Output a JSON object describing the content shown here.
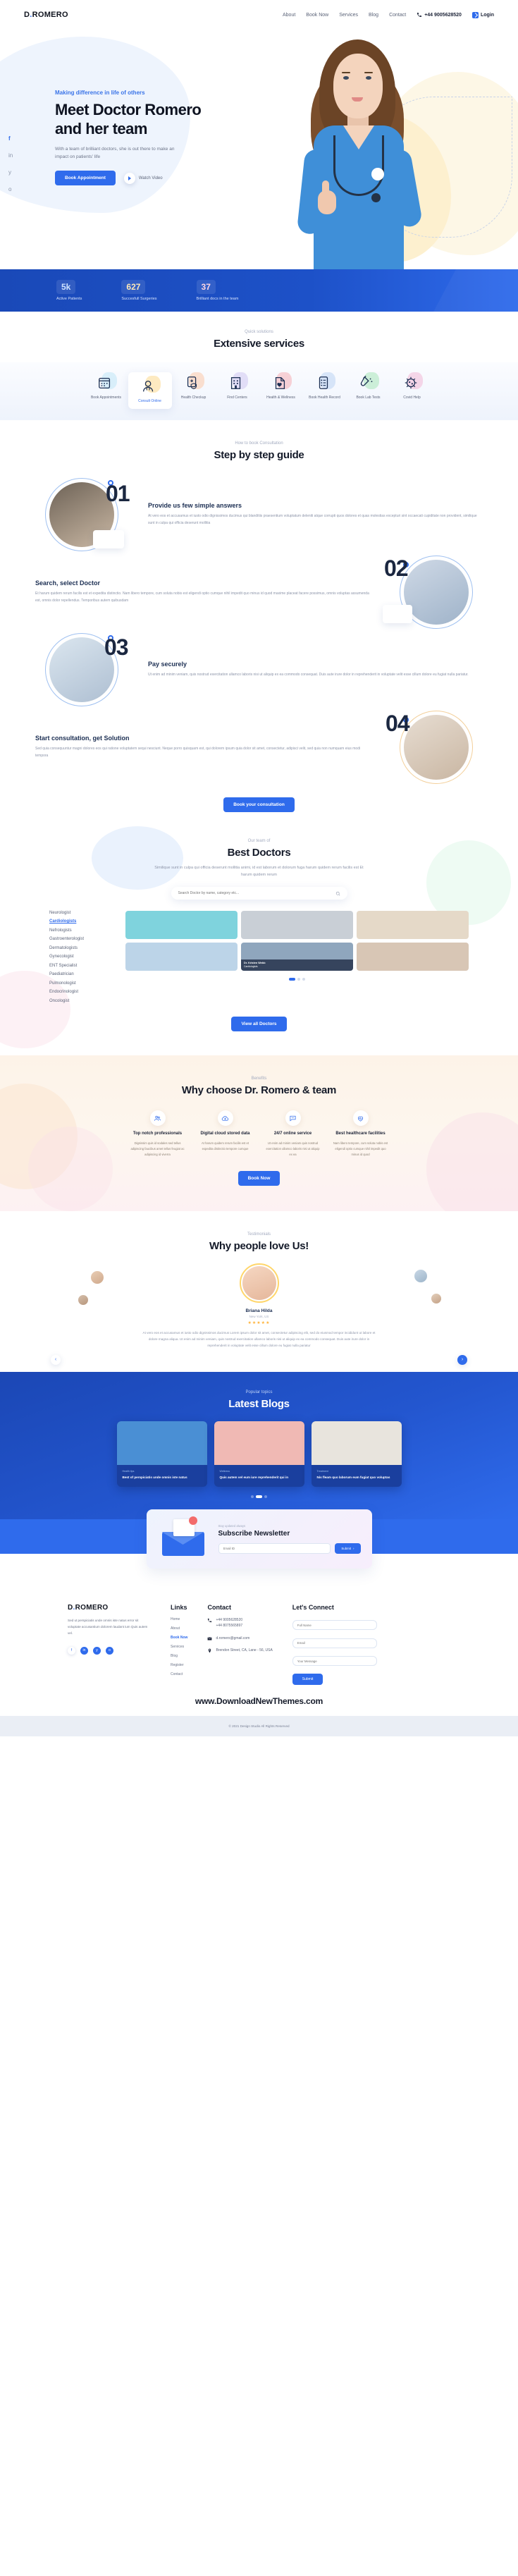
{
  "brand": {
    "name_prefix": "D",
    "name_dot": ".",
    "name_suffix": "ROMERO",
    "full": "D.ROMERO"
  },
  "nav": {
    "links": [
      {
        "label": "About"
      },
      {
        "label": "Book Now"
      },
      {
        "label": "Services"
      },
      {
        "label": "Blog"
      },
      {
        "label": "Contact"
      }
    ],
    "phone": "+44 9005628520",
    "login": "Login"
  },
  "hero": {
    "eyebrow": "Making difference in life of others",
    "title": "Meet Doctor Romero and her team",
    "description": "With a team of brilliant doctors, she is out there to make an impact on patients' life",
    "cta": "Book Appointment",
    "play_label": "Watch Video",
    "social": [
      "f",
      "in",
      "y",
      "o"
    ]
  },
  "stats": [
    {
      "value": "5k",
      "label": "Active Patients",
      "color": "#cfe4ff"
    },
    {
      "value": "627",
      "label": "Succesfull Surgeries",
      "color": "#fbe7b8"
    },
    {
      "value": "37",
      "label": "Brilliant docs in the team",
      "color": "#fbd6e3"
    }
  ],
  "services": {
    "eyebrow": "Quick solutions",
    "title": "Extensive services",
    "items": [
      {
        "label": "Book Appointments",
        "icon": "calendar-icon",
        "blob": "#bfe6f5",
        "active": false
      },
      {
        "label": "Consult Online",
        "icon": "doctor-avatar-icon",
        "blob": "#fbd98e",
        "active": true
      },
      {
        "label": "Health Checkup",
        "icon": "clipboard-shield-icon",
        "blob": "#fbc9a8",
        "active": false
      },
      {
        "label": "Find Centers",
        "icon": "hospital-icon",
        "blob": "#cfc6f0",
        "active": false
      },
      {
        "label": "Health & Wellness",
        "icon": "heart-pulse-doc-icon",
        "blob": "#f6aeb4",
        "active": false
      },
      {
        "label": "Book Health Record",
        "icon": "record-list-icon",
        "blob": "#bcd3f3",
        "active": false
      },
      {
        "label": "Book Lab Tests",
        "icon": "test-tube-icon",
        "blob": "#a8e6b8",
        "active": false
      },
      {
        "label": "Covid Help",
        "icon": "virus-icon",
        "blob": "#f3b8d6",
        "active": false
      }
    ]
  },
  "steps": {
    "eyebrow": "How to book Consultation",
    "title": "Step by step guide",
    "items": [
      {
        "number": "01",
        "heading": "Provide us few simple answers",
        "body": "At vero eos et accusamus et iusto odio dignissimos ducimus qui blanditiis praesentium voluptatum deleniti atque corrupti quos dolores et quas molestias excepturi sint occaecati cupiditate non provident, similique sunt in culpa qui officia deserunt mollitia"
      },
      {
        "number": "02",
        "heading": "Search, select Doctor",
        "body": "Et harum quidem rerum facilis est et expedita distinctio. Nam libero tempore, cum soluta nobis est eligendi optio cumque nihil impedit quo minus id quod maxime placeat facere possimus, omnis voluptas assumenda est, omnis dolor repellendus. Temporibus autem quibusdam"
      },
      {
        "number": "03",
        "heading": "Pay securely",
        "body": "Ut enim ad minim veniam, quis nostrud exercitation ullamco laboris nisi ut aliquip ex ea commodo consequat. Duis aute irure dolor in reprehenderit in voluptate velit esse cillum dolore eu fugiat nulla pariatur."
      },
      {
        "number": "04",
        "heading": "Start consultation, get Solution",
        "body": "Sed quia consequuntur magni dolores eos qui ratione voluptatem sequi nesciunt. Neque porro quisquam est, qui dolorem ipsum quia dolor sit amet, consectetur, adipisci velit, sed quia non numquam eius modi tempora"
      }
    ],
    "cta": "Book your consultation"
  },
  "doctors": {
    "eyebrow": "Our team of",
    "title": "Best Doctors",
    "subtitle": "Similique sunt in culpa qui officia deserunt mollitia animi, id est laborum et dolorum fuga harum quidem rerum facilis est Et harum quidem rerum",
    "search_placeholder": "Search Doctor by name, category etc...",
    "specialties": [
      {
        "label": "Neurologist",
        "active": false
      },
      {
        "label": "Cardiologists",
        "active": true
      },
      {
        "label": "Nefrologists",
        "active": false
      },
      {
        "label": "Gastroenterologist",
        "active": false
      },
      {
        "label": "Dermatologists",
        "active": false
      },
      {
        "label": "Gynecologist",
        "active": false
      },
      {
        "label": "ENT Specialist",
        "active": false
      },
      {
        "label": "Paediatrician",
        "active": false
      },
      {
        "label": "Pulmonologist",
        "active": false
      },
      {
        "label": "Endocrinologist",
        "active": false
      },
      {
        "label": "Oncologist",
        "active": false
      }
    ],
    "cards": [
      {
        "name": "",
        "role": "",
        "bg": "#7fd3dd",
        "featured": false
      },
      {
        "name": "",
        "role": "",
        "bg": "#c9cfd6",
        "featured": false
      },
      {
        "name": "",
        "role": "",
        "bg": "#e5d9c8",
        "featured": false
      },
      {
        "name": "",
        "role": "",
        "bg": "#bcd4e8",
        "featured": false
      },
      {
        "name": "Dr. Kristen Webb",
        "role": "Cardiologists",
        "bg": "#8fa6bd",
        "featured": true
      },
      {
        "name": "",
        "role": "",
        "bg": "#d8c6b5",
        "featured": false
      }
    ],
    "cta": "View all Doctors",
    "page_dots": 3,
    "active_dot": 0
  },
  "why": {
    "eyebrow": "Benefits",
    "title": "Why choose Dr. Romero & team",
    "items": [
      {
        "icon": "team-icon",
        "heading": "Top notch professionals",
        "body": "Dignissim quis id sodales sed tellus adipiscing faucibus amet tellus feugiat ac adipiscing id viverra"
      },
      {
        "icon": "cloud-icon",
        "heading": "Digital cloud stored data",
        "body": "At harum quidem rerum facilis est et expedita distinctio tempore cumque"
      },
      {
        "icon": "chat-support-icon",
        "heading": "24/7 online service",
        "body": "Ut enim ad minim veniam quis nostrud exercitation ullamco laboris nisi ut aliquip ex ea"
      },
      {
        "icon": "heart-care-icon",
        "heading": "Best healthcare facilities",
        "body": "Nam libero tempore, cum soluta nobis est eligendi optio cumque nihil impedit quo minus id quod"
      }
    ],
    "cta": "Book Now"
  },
  "testimonial": {
    "eyebrow": "Testimonials",
    "title": "Why people love Us!",
    "name": "Briana Hilda",
    "location": "New York, US",
    "stars": "★★★★★",
    "quote": "At vero eos et accusamus et iusto odio dignissimos ducimus Lorem ipsum dolor sit amet, consectetur adipiscing elit, sed do eiusmod tempor incididunt ut labore et dolore magna aliqua. Ut enim ad minim veniam, quis nostrud exercitation ullamco laboris nisi ut aliquip ex ea commodo consequat. Duis aute irure dolor in reprehenderit in voluptate velit esse cillum dolore eu fugiat nulla pariatur",
    "prev": "‹",
    "next": "›"
  },
  "blogs": {
    "eyebrow": "Popular topics",
    "title": "Latest Blogs",
    "cards": [
      {
        "tag": "Health tips",
        "title": "Best of perspiciatis unde omnis iste natus",
        "bg": "#4a8fd4"
      },
      {
        "tag": "Wellness",
        "title": "Quis autem vel eum iure reprehenderit qui in",
        "bg": "#f0b9b4"
      },
      {
        "tag": "Treatment",
        "title": "Nis fleam quo laborum eum fugiat quo voluptas",
        "bg": "#e8e4dd"
      }
    ],
    "dots": 3,
    "active_dot": 1
  },
  "newsletter": {
    "eyebrow": "Stay updated always",
    "title": "Subscribe Newsletter",
    "email_placeholder": "Email ID",
    "button": "Submit"
  },
  "footer": {
    "about": "Sed ut perspiciatis unde omnis iste natus error sit voluptate accusantium dolorem laudant ium Quis autem vel.",
    "social": [
      "f",
      "in",
      "y",
      "o"
    ],
    "links_heading": "Links",
    "links": [
      {
        "label": "Home",
        "active": false
      },
      {
        "label": "About",
        "active": false
      },
      {
        "label": "Book Now",
        "active": true
      },
      {
        "label": "Services",
        "active": false
      },
      {
        "label": "Blog",
        "active": false
      },
      {
        "label": "Register",
        "active": false
      },
      {
        "label": "Contact",
        "active": false
      }
    ],
    "contact_heading": "Contact",
    "phone1": "+44 9005628520",
    "phone2": "+44 8075565897",
    "email": "d.romero@gmail.com",
    "address": "Brendon Street, CA, Lane - 56, USA",
    "connect_heading": "Let's Connect",
    "form": {
      "name_placeholder": "Full Name",
      "email_placeholder": "Email",
      "message_placeholder": "Your Message",
      "submit": "Submit"
    },
    "watermark": "www.DownloadNewThemes.com",
    "copyright": "© 2021 Design Studio All Rights Reserved"
  }
}
